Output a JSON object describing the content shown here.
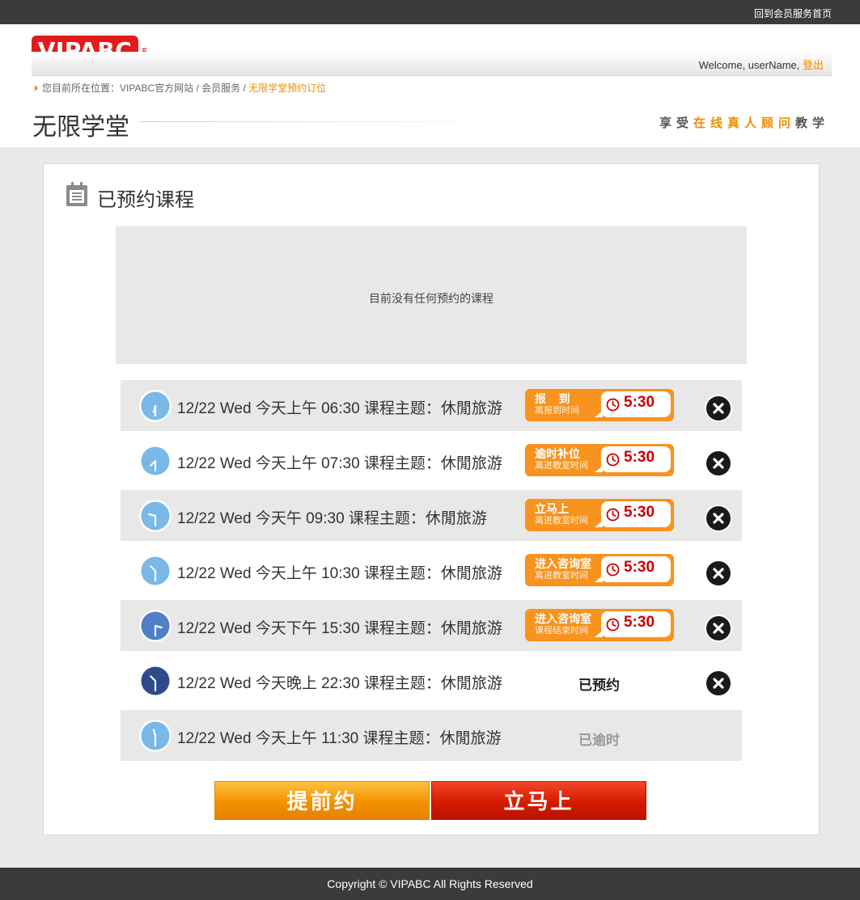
{
  "topbar": {
    "home_link": "回到会员服务首页"
  },
  "header": {
    "logo_text": "VIPABC",
    "logo_suffix": ".com",
    "welcome_prefix": "Welcome, userName, ",
    "logout_label": "登出",
    "breadcrumb_prefix": "您目前所在位置：VIPABC官方网站 / 会员服务 / ",
    "breadcrumb_current": "无限学堂预约订位",
    "page_title": "无限学堂",
    "slogan": {
      "part1": "享受",
      "highlight": "在线真人顾问",
      "part2": "教学"
    }
  },
  "panel": {
    "title": "已预约课程",
    "empty_message": "目前没有任何预约的课程"
  },
  "sessions": [
    {
      "text": "12/22 Wed 今天上午 06:30 课程主题：休閒旅游",
      "clock_hour": 6,
      "clock_color": "#7ab8e8",
      "badge_label": "报    到",
      "badge_sub": "离报到时间",
      "timer": "5:30",
      "closable": true
    },
    {
      "text": "12/22 Wed 今天上午 07:30 课程主题：休閒旅游",
      "clock_hour": 7,
      "clock_color": "#7ab8e8",
      "badge_label": "逾时补位",
      "badge_sub": "离进教室时间",
      "timer": "5:30",
      "closable": true
    },
    {
      "text": "12/22 Wed 今天午 09:30 课程主题：休閒旅游",
      "clock_hour": 9,
      "clock_color": "#7ab8e8",
      "badge_label": "立马上",
      "badge_sub": "离进教室时间",
      "timer": "5:30",
      "closable": true
    },
    {
      "text": "12/22 Wed 今天上午 10:30 课程主题：休閒旅游",
      "clock_hour": 10,
      "clock_color": "#7ab8e8",
      "badge_label": "进入咨询室",
      "badge_sub": "离进教室时间",
      "timer": "5:30",
      "closable": true
    },
    {
      "text": "12/22 Wed 今天下午 15:30 课程主题：休閒旅游",
      "clock_hour": 15,
      "clock_color": "#4f7fc4",
      "badge_label": "进入咨询室",
      "badge_sub": "课程结束时间",
      "timer": "5:30",
      "closable": true
    },
    {
      "text": "12/22 Wed 今天晚上 22:30 课程主题：休閒旅游",
      "clock_hour": 22,
      "clock_color": "#2e4a8c",
      "status": "已预约",
      "closable": true
    },
    {
      "text": "12/22 Wed 今天上午 11:30 课程主题：休閒旅游",
      "clock_hour": 11,
      "clock_color": "#7ab8e8",
      "status": "已逾时",
      "closable": false
    }
  ],
  "buttons": {
    "early": "提前约",
    "now": "立马上"
  },
  "footer": {
    "copyright": "Copyright © VIPABC All Rights Reserved"
  },
  "colors": {
    "accent": "#f08c00",
    "badge": "#f7931e",
    "timer_text": "#cc0000",
    "brand_red": "#e31b1b"
  },
  "icons": {
    "panel_icon": "calendar-icon",
    "row_icon": "clock-icon",
    "timer_icon": "clock-icon",
    "close_icon": "close-icon"
  }
}
